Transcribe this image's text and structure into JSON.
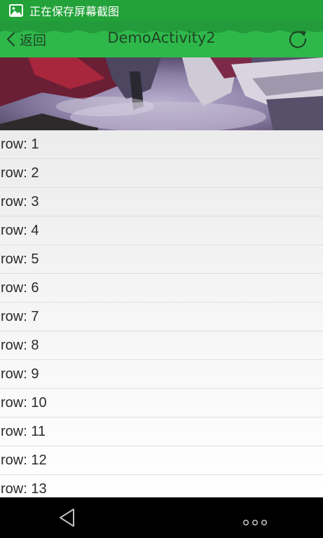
{
  "status_bar": {
    "message": "正在保存屏幕截图",
    "icon": "image-icon"
  },
  "header": {
    "back_label": "返回",
    "title": "DemoActivity2",
    "refresh_icon": "refresh-icon",
    "accent_color": "#2fb84a"
  },
  "list": {
    "rows": [
      "row: 1",
      "row: 2",
      "row: 3",
      "row: 4",
      "row: 5",
      "row: 6",
      "row: 7",
      "row: 8",
      "row: 9",
      "row: 10",
      "row: 11",
      "row: 12",
      "row: 13"
    ]
  },
  "nav_bar": {
    "back_icon": "triangle-back-icon",
    "more_icon": "more-dots-icon"
  }
}
